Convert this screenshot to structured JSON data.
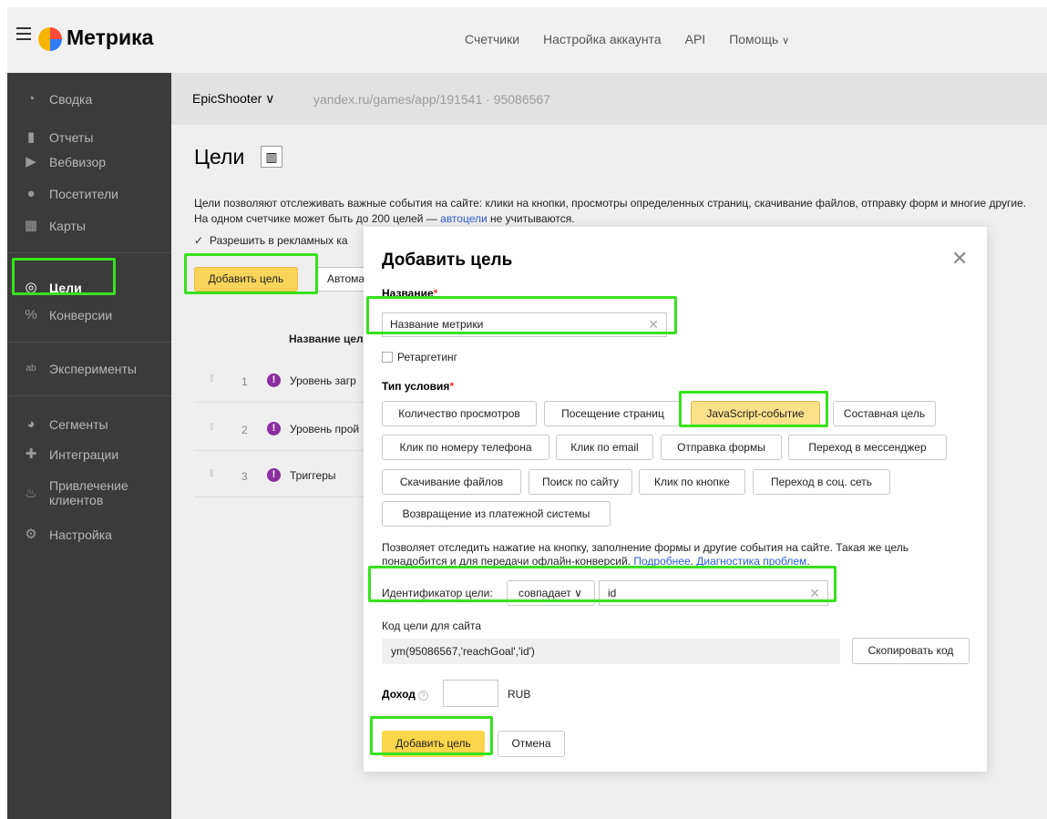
{
  "header": {
    "logo_text": "Метрика",
    "nav": [
      "Счетчики",
      "Настройка аккаунта",
      "API",
      "Помощь"
    ],
    "help_chevron": "∨"
  },
  "sidebar": {
    "items": [
      {
        "label": "Сводка",
        "icon": "gauge-icon",
        "glyph": "◔"
      },
      {
        "label": "Отчеты",
        "icon": "bar-chart-icon",
        "glyph": "▮"
      },
      {
        "label": "Вебвизор",
        "icon": "play-icon",
        "glyph": "▶"
      },
      {
        "label": "Посетители",
        "icon": "user-icon",
        "glyph": "●"
      },
      {
        "label": "Карты",
        "icon": "map-icon",
        "glyph": "▦"
      },
      {
        "label": "Цели",
        "icon": "target-icon",
        "glyph": "◎"
      },
      {
        "label": "Конверсии",
        "icon": "percent-icon",
        "glyph": "%"
      },
      {
        "label": "Эксперименты",
        "icon": "ab-icon",
        "glyph": "ab"
      },
      {
        "label": "Сегменты",
        "icon": "pie-icon",
        "glyph": "◕"
      },
      {
        "label": "Интеграции",
        "icon": "puzzle-icon",
        "glyph": "✚"
      },
      {
        "label": "Привлечение",
        "label2": "клиентов",
        "icon": "flame-icon",
        "glyph": "♨"
      },
      {
        "label": "Настройка",
        "icon": "gear-icon",
        "glyph": "⚙"
      }
    ],
    "active": "Цели"
  },
  "crumb": {
    "counter": "EpicShooter ∨",
    "url": "yandex.ru/games/app/191541 · 95086567"
  },
  "page": {
    "title": "Цели",
    "desc_part1": "Цели позволяют отслеживать важные события на сайте: клики на кнопки, просмотры определенных страниц, скачивание файлов, отправку форм и многие другие. На одном счетчике может быть до 200 целей — ",
    "desc_link": "автоцели",
    "desc_part2": " не учитываются.",
    "allow_label": "Разрешить в рекламных ка",
    "add_goal": "Добавить цель",
    "auto_btn": "Автома",
    "table_header": "Название цел",
    "goals": [
      {
        "num": "1",
        "name": "Уровень загр"
      },
      {
        "num": "2",
        "name": "Уровень прой"
      },
      {
        "num": "3",
        "name": "Триггеры"
      }
    ]
  },
  "modal": {
    "title": "Добавить цель",
    "name_label": "Название",
    "name_value": "Название метрики",
    "retarget_label": "Ретаргетинг",
    "type_label": "Тип условия",
    "types": [
      "Количество просмотров",
      "Посещение страниц",
      "JavaScript-событие",
      "Составная цель",
      "Клик по номеру телефона",
      "Клик по email",
      "Отправка формы",
      "Переход в мессенджер",
      "Скачивание файлов",
      "Поиск по сайту",
      "Клик по кнопке",
      "Переход в соц. сеть",
      "Возвращение из платежной системы"
    ],
    "selected_type": "JavaScript-событие",
    "cond_desc": "Позволяет отследить нажатие на кнопку, заполнение формы и другие события на сайте. Такая же цель понадобится и для передачи офлайн-конверсий. ",
    "cond_link1": "Подробнее",
    "cond_link2": "Диагностика проблем",
    "id_label": "Идентификатор цели:",
    "match_value": "совпадает ∨",
    "id_value": "id",
    "code_label": "Код цели для сайта",
    "code_value": "ym(95086567,'reachGoal','id')",
    "copy_btn": "Скопировать код",
    "income_label": "Доход",
    "currency": "RUB",
    "submit": "Добавить цель",
    "cancel": "Отмена"
  },
  "colors": {
    "highlight": "#36e21c",
    "sidebar_bg": "#3b3b3b",
    "primary_button": "#fbd54a",
    "link": "#2a5bd7"
  }
}
